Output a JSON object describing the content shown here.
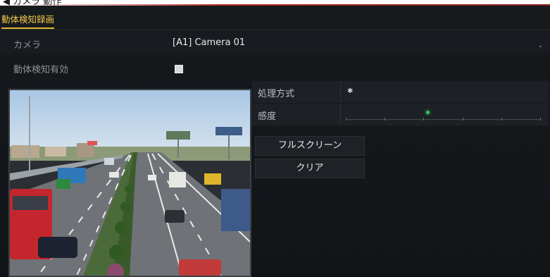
{
  "top_strip": {
    "fragment": "◀ カメラ  動作"
  },
  "tab": {
    "label": "動体検知録画"
  },
  "camera_row": {
    "label": "カメラ",
    "value": "[A1] Camera 01"
  },
  "enable_row": {
    "label": "動体検知有効",
    "checked": true
  },
  "options": [
    {
      "label": "処理方式",
      "icon": "gear-icon"
    },
    {
      "label": "感度",
      "sensitivity_level": 0.42
    }
  ],
  "buttons": {
    "fullscreen": "フルスクリーン",
    "clear": "クリア"
  },
  "colors": {
    "accent": "#f3c84a",
    "knob": "#38c15a",
    "background": "#121518"
  }
}
